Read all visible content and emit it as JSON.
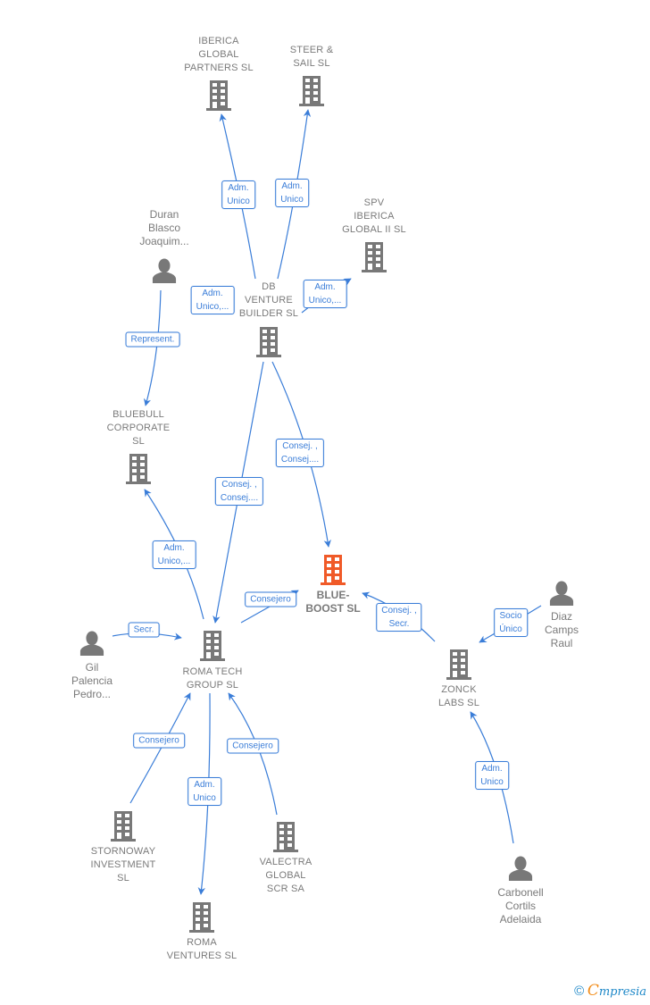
{
  "colors": {
    "edge": "#3a7dd8",
    "node": "#787878",
    "focus_node": "#f05a28",
    "label_text": "#7a7a7a"
  },
  "nodes": [
    {
      "id": "iberica_global_partners",
      "type": "company",
      "label_lines": [
        "IBERICA",
        "GLOBAL",
        "PARTNERS  SL"
      ],
      "icon": "building-icon"
    },
    {
      "id": "steer_sail",
      "type": "company",
      "label_lines": [
        "STEER &",
        "SAIL  SL"
      ],
      "icon": "building-icon"
    },
    {
      "id": "spv_iberica_global_ii",
      "type": "company",
      "label_lines": [
        "SPV",
        "IBERICA",
        "GLOBAL II  SL"
      ],
      "icon": "building-icon"
    },
    {
      "id": "duran_blasco",
      "type": "person",
      "label_lines": [
        "Duran",
        "Blasco",
        "Joaquim..."
      ],
      "icon": "person-icon"
    },
    {
      "id": "db_venture_builder",
      "type": "company",
      "label_lines": [
        "DB",
        "VENTURE",
        "BUILDER  SL"
      ],
      "icon": "building-icon"
    },
    {
      "id": "bluebull_corporate",
      "type": "company",
      "label_lines": [
        "BLUEBULL",
        "CORPORATE",
        "SL"
      ],
      "icon": "building-icon"
    },
    {
      "id": "blue_boost",
      "type": "focus",
      "label_lines": [
        "BLUE-",
        "BOOST  SL"
      ],
      "icon": "building-icon"
    },
    {
      "id": "diaz_camps",
      "type": "person",
      "label_lines": [
        "Diaz",
        "Camps",
        "Raul"
      ],
      "icon": "person-icon"
    },
    {
      "id": "gil_palencia",
      "type": "person",
      "label_lines": [
        "Gil",
        "Palencia",
        "Pedro..."
      ],
      "icon": "person-icon"
    },
    {
      "id": "roma_tech_group",
      "type": "company",
      "label_lines": [
        "ROMA TECH",
        "GROUP  SL"
      ],
      "icon": "building-icon"
    },
    {
      "id": "zonck_labs",
      "type": "company",
      "label_lines": [
        "ZONCK",
        "LABS  SL"
      ],
      "icon": "building-icon"
    },
    {
      "id": "stornoway_investment",
      "type": "company",
      "label_lines": [
        "STORNOWAY",
        "INVESTMENT",
        "SL"
      ],
      "icon": "building-icon"
    },
    {
      "id": "valectra_global",
      "type": "company",
      "label_lines": [
        "VALECTRA",
        "GLOBAL",
        "SCR SA"
      ],
      "icon": "building-icon"
    },
    {
      "id": "roma_ventures",
      "type": "company",
      "label_lines": [
        "ROMA",
        "VENTURES  SL"
      ],
      "icon": "building-icon"
    },
    {
      "id": "carbonell_cortils",
      "type": "person",
      "label_lines": [
        "Carbonell",
        "Cortils",
        "Adelaida"
      ],
      "icon": "person-icon"
    }
  ],
  "edges": [
    {
      "from": "db_venture_builder",
      "to": "iberica_global_partners",
      "label_lines": [
        "Adm.",
        "Unico"
      ]
    },
    {
      "from": "db_venture_builder",
      "to": "steer_sail",
      "label_lines": [
        "Adm.",
        "Unico"
      ]
    },
    {
      "from": "db_venture_builder",
      "to": "spv_iberica_global_ii",
      "label_lines": [
        "Adm.",
        "Unico,..."
      ]
    },
    {
      "from": "db_venture_builder",
      "to": "db_venture_builder",
      "label_lines": [
        "Adm.",
        "Unico,..."
      ]
    },
    {
      "from": "duran_blasco",
      "to": "bluebull_corporate",
      "label_lines": [
        "Represent."
      ]
    },
    {
      "from": "db_venture_builder",
      "to": "blue_boost",
      "label_lines": [
        "Consej. ,",
        "Consej...."
      ]
    },
    {
      "from": "db_venture_builder",
      "to": "roma_tech_group",
      "label_lines": [
        "Consej. ,",
        "Consej...."
      ]
    },
    {
      "from": "roma_tech_group",
      "to": "bluebull_corporate",
      "label_lines": [
        "Adm.",
        "Unico,..."
      ]
    },
    {
      "from": "roma_tech_group",
      "to": "blue_boost",
      "label_lines": [
        "Consejero"
      ]
    },
    {
      "from": "zonck_labs",
      "to": "blue_boost",
      "label_lines": [
        "Consej. ,",
        "Secr."
      ]
    },
    {
      "from": "diaz_camps",
      "to": "zonck_labs",
      "label_lines": [
        "Socio",
        "Único"
      ]
    },
    {
      "from": "gil_palencia",
      "to": "roma_tech_group",
      "label_lines": [
        "Secr."
      ]
    },
    {
      "from": "stornoway_investment",
      "to": "roma_tech_group",
      "label_lines": [
        "Consejero"
      ]
    },
    {
      "from": "valectra_global",
      "to": "roma_tech_group",
      "label_lines": [
        "Consejero"
      ]
    },
    {
      "from": "roma_tech_group",
      "to": "roma_ventures",
      "label_lines": [
        "Adm.",
        "Unico"
      ]
    },
    {
      "from": "carbonell_cortils",
      "to": "zonck_labs",
      "label_lines": [
        "Adm.",
        "Unico"
      ]
    }
  ],
  "footer": {
    "copyright": "©",
    "brand_initial": "C",
    "brand_rest": "mpresia"
  }
}
